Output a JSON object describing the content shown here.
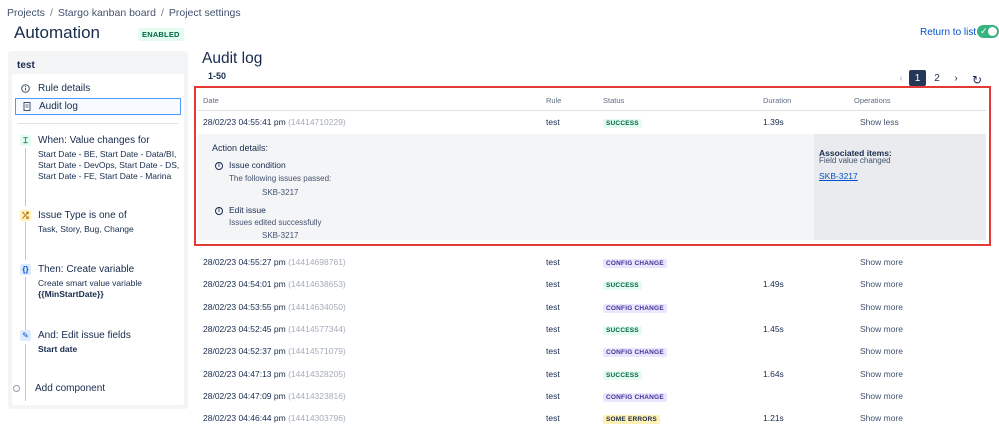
{
  "breadcrumb": {
    "items": [
      "Projects",
      "Stargo kanban board",
      "Project settings"
    ],
    "sep": "/"
  },
  "header": {
    "title": "Automation",
    "status_badge": "ENABLED",
    "return_label": "Return to list"
  },
  "sidebar": {
    "rule_name": "test",
    "nav": [
      {
        "label": "Rule details"
      },
      {
        "label": "Audit log"
      }
    ],
    "components": [
      {
        "title": "When: Value changes for",
        "body": "Start Date - BE, Start Date - Data/BI, Start Date - DevOps, Start Date - DS, Start Date - FE, Start Date - Marina",
        "icon": "trigger-icon"
      },
      {
        "title": "Issue Type is one of",
        "body": "Task, Story, Bug, Change",
        "icon": "condition-icon"
      },
      {
        "title": "Then: Create variable",
        "body": "Create smart value variable",
        "body_bold": "{{MinStartDate}}",
        "icon": "variable-icon"
      },
      {
        "title": "And: Edit issue fields",
        "body_bold": "Start date",
        "icon": "edit-icon"
      }
    ],
    "add_component": "Add component"
  },
  "main": {
    "title": "Audit log",
    "range": "1-50",
    "pagination": {
      "pages": [
        "1",
        "2"
      ],
      "current": "1",
      "prev": "‹",
      "next": "›"
    },
    "columns": {
      "date": "Date",
      "rule": "Rule",
      "status": "Status",
      "duration": "Duration",
      "operations": "Operations"
    },
    "expanded": {
      "date": "28/02/23 04:55:41 pm",
      "id": "(14414710229)",
      "rule": "test",
      "status": "SUCCESS",
      "duration": "1.39s",
      "op": "Show less",
      "action_header": "Action details:",
      "cond_title": "Issue condition",
      "cond_sub": "The following issues passed:",
      "cond_key": "SKB-3217",
      "edit_title": "Edit issue",
      "edit_sub": "Issues edited successfully",
      "edit_key": "SKB-3217",
      "assoc_title": "Associated items:",
      "assoc_sub": "Field value changed",
      "assoc_link": "SKB-3217"
    },
    "rows": [
      {
        "date": "28/02/23 04:55:27 pm",
        "id": "(14414698761)",
        "rule": "test",
        "status": "CONFIG CHANGE",
        "duration": "",
        "op": "Show more"
      },
      {
        "date": "28/02/23 04:54:01 pm",
        "id": "(14414638653)",
        "rule": "test",
        "status": "SUCCESS",
        "duration": "1.49s",
        "op": "Show more"
      },
      {
        "date": "28/02/23 04:53:55 pm",
        "id": "(14414634050)",
        "rule": "test",
        "status": "CONFIG CHANGE",
        "duration": "",
        "op": "Show more"
      },
      {
        "date": "28/02/23 04:52:45 pm",
        "id": "(14414577344)",
        "rule": "test",
        "status": "SUCCESS",
        "duration": "1.45s",
        "op": "Show more"
      },
      {
        "date": "28/02/23 04:52:37 pm",
        "id": "(14414571079)",
        "rule": "test",
        "status": "CONFIG CHANGE",
        "duration": "",
        "op": "Show more"
      },
      {
        "date": "28/02/23 04:47:13 pm",
        "id": "(14414328205)",
        "rule": "test",
        "status": "SUCCESS",
        "duration": "1.64s",
        "op": "Show more"
      },
      {
        "date": "28/02/23 04:47:09 pm",
        "id": "(14414323816)",
        "rule": "test",
        "status": "CONFIG CHANGE",
        "duration": "",
        "op": "Show more"
      },
      {
        "date": "28/02/23 04:46:44 pm",
        "id": "(14414303796)",
        "rule": "test",
        "status": "SOME ERRORS",
        "duration": "1.21s",
        "op": "Show more"
      }
    ]
  },
  "colors": {
    "accent": "#0052cc",
    "success": "#36b37e",
    "highlight": "#e53935"
  }
}
